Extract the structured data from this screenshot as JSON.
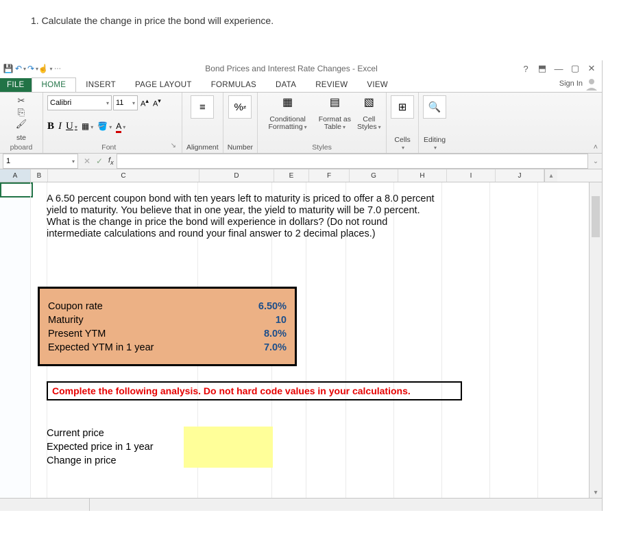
{
  "question": "1. Calculate the change in price the bond will experience.",
  "title": "Bond Prices and Interest Rate Changes - Excel",
  "signin": "Sign In",
  "tabs": {
    "file": "FILE",
    "home": "HOME",
    "insert": "INSERT",
    "page_layout": "PAGE LAYOUT",
    "formulas": "FORMULAS",
    "data": "DATA",
    "review": "REVIEW",
    "view": "VIEW"
  },
  "ribbon": {
    "paste": "ste",
    "clipboard": "pboard",
    "font_name": "Calibri",
    "font_size": "11",
    "font": "Font",
    "alignment": "Alignment",
    "number": "Number",
    "cond_fmt": "Conditional Formatting",
    "fmt_table": "Format as Table",
    "cell_styles": "Cell Styles",
    "styles": "Styles",
    "cells": "Cells",
    "editing": "Editing"
  },
  "namebox": "1",
  "cols": {
    "A": "A",
    "B": "B",
    "C": "C",
    "D": "D",
    "E": "E",
    "F": "F",
    "G": "G",
    "H": "H",
    "I": "I",
    "J": "J"
  },
  "problem": "A 6.50 percent coupon bond with ten years left to maturity is priced to offer a 8.0 percent yield to maturity. You believe that in one year, the yield to maturity will be 7.0 percent. What is the change in price the bond will experience in dollars? (Do not round intermediate calculations and round your final answer to 2 decimal places.)",
  "inputs": {
    "coupon_rate_lbl": "Coupon rate",
    "coupon_rate_val": "6.50%",
    "maturity_lbl": "Maturity",
    "maturity_val": "10",
    "present_ytm_lbl": "Present YTM",
    "present_ytm_val": "8.0%",
    "exp_ytm_lbl": "Expected YTM in 1 year",
    "exp_ytm_val": "7.0%"
  },
  "instruction": "Complete the following analysis. Do not hard code values in your calculations.",
  "answers": {
    "current_price": "Current price",
    "expected_price": "Expected price in 1 year",
    "change_price": "Change in price"
  }
}
